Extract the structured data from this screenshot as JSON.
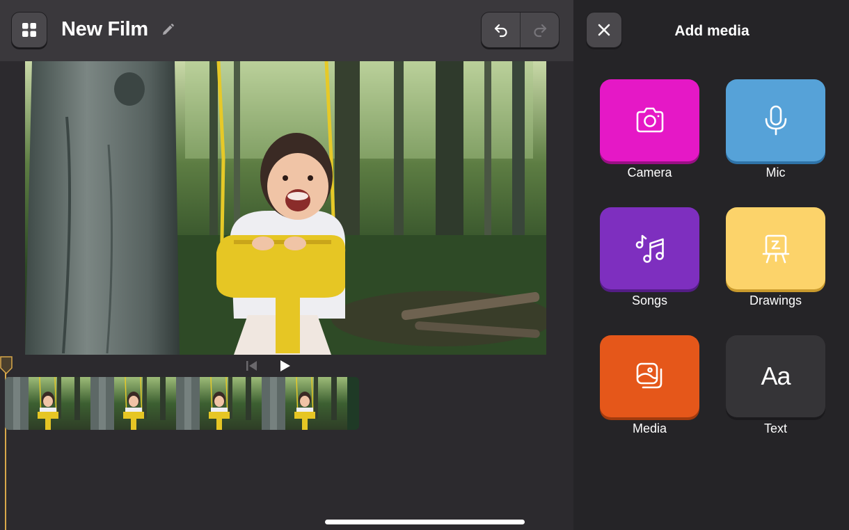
{
  "header": {
    "title": "New Film",
    "grid_icon": "grid-icon",
    "edit_icon": "pencil-icon",
    "undo_icon": "undo-icon",
    "redo_icon": "redo-icon"
  },
  "transport": {
    "skip_icon": "skip-to-start-icon",
    "play_icon": "play-icon"
  },
  "panel": {
    "title": "Add media",
    "close_icon": "close-icon",
    "tiles": [
      {
        "label": "Camera",
        "icon": "camera-icon",
        "color": "#e518c6"
      },
      {
        "label": "Mic",
        "icon": "microphone-icon",
        "color": "#56a2d8"
      },
      {
        "label": "Songs",
        "icon": "music-notes-icon",
        "color": "#7e2fbf"
      },
      {
        "label": "Drawings",
        "icon": "easel-icon",
        "color": "#fcd36a"
      },
      {
        "label": "Media",
        "icon": "photo-stack-icon",
        "color": "#e5571a"
      },
      {
        "label": "Text",
        "icon": "text-aa-icon",
        "color": "#353437",
        "glyph": "Aa"
      }
    ]
  },
  "colors": {
    "background": "#2c2a2e",
    "panel": "#252427",
    "playhead": "#d9a84a"
  }
}
